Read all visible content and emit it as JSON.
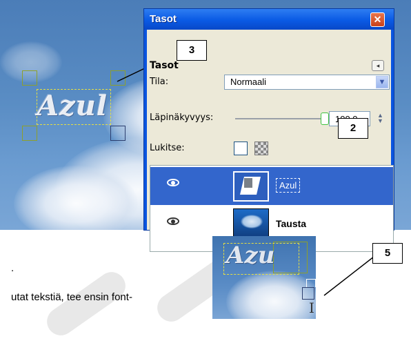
{
  "canvas": {
    "layer_text": "Azul"
  },
  "dialog": {
    "title": "Tasot",
    "close_symbol": "✕",
    "tab_heading": "Tasot",
    "mode_label": "Tila:",
    "mode_value": "Normaali",
    "opacity_label": "Läpinäkyvyys:",
    "opacity_value": "100,0",
    "lock_label": "Lukitse:",
    "layers": [
      {
        "name": "Azul",
        "selected": true,
        "icon": "eye-icon"
      },
      {
        "name": "Tausta",
        "selected": false,
        "icon": "eye-icon"
      }
    ],
    "dropdown_icon": "chevron-down-icon",
    "menu_icon": "panel-menu-icon"
  },
  "callouts": {
    "c3": "3",
    "c2": "2",
    "c5": "5"
  },
  "bottom_text": {
    "line1": ".",
    "line2": "utat tekstiä, tee ensin font-"
  },
  "small_canvas": {
    "layer_text": "Azu"
  },
  "colors": {
    "selection_blue": "#3366cc",
    "title_blue": "#0a55e0",
    "handle_green": "#8ea02a",
    "frame_yellow": "#e8e040"
  }
}
